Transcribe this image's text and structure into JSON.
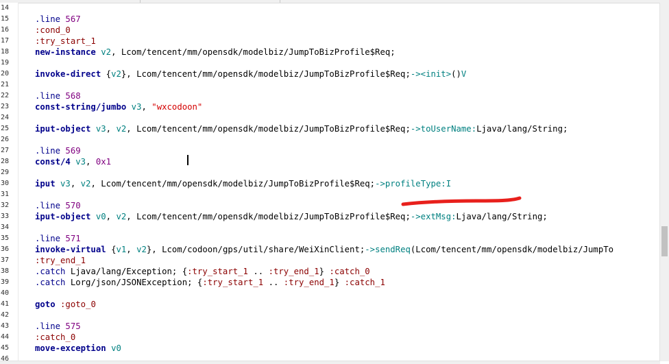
{
  "editor": {
    "lines": [
      {
        "n": "14",
        "segs": []
      },
      {
        "n": "15",
        "segs": [
          {
            "c": "dir",
            "t": ".line "
          },
          {
            "c": "num",
            "t": "567"
          }
        ]
      },
      {
        "n": "16",
        "segs": [
          {
            "c": "lbl",
            "t": ":cond_0"
          }
        ]
      },
      {
        "n": "17",
        "segs": [
          {
            "c": "lbl",
            "t": ":try_start_1"
          }
        ]
      },
      {
        "n": "18",
        "segs": [
          {
            "c": "kw",
            "t": "new-instance "
          },
          {
            "c": "reg",
            "t": "v2"
          },
          {
            "c": "punc",
            "t": ", Lcom/tencent/mm/opensdk/modelbiz/JumpToBizProfile$Req;"
          }
        ]
      },
      {
        "n": "19",
        "segs": []
      },
      {
        "n": "20",
        "segs": [
          {
            "c": "kw",
            "t": "invoke-direct "
          },
          {
            "c": "punc",
            "t": "{"
          },
          {
            "c": "reg",
            "t": "v2"
          },
          {
            "c": "punc",
            "t": "}, Lcom/tencent/mm/opensdk/modelbiz/JumpToBizProfile$Req;"
          },
          {
            "c": "mem",
            "t": "-><init>"
          },
          {
            "c": "punc",
            "t": "()"
          },
          {
            "c": "mem",
            "t": "V"
          }
        ]
      },
      {
        "n": "21",
        "segs": []
      },
      {
        "n": "22",
        "segs": [
          {
            "c": "dir",
            "t": ".line "
          },
          {
            "c": "num",
            "t": "568"
          }
        ]
      },
      {
        "n": "23",
        "segs": [
          {
            "c": "kw",
            "t": "const-string/jumbo "
          },
          {
            "c": "reg",
            "t": "v3"
          },
          {
            "c": "punc",
            "t": ", "
          },
          {
            "c": "str",
            "t": "\"wxcodoon\""
          }
        ]
      },
      {
        "n": "24",
        "segs": []
      },
      {
        "n": "25",
        "segs": [
          {
            "c": "kw",
            "t": "iput-object "
          },
          {
            "c": "reg",
            "t": "v3"
          },
          {
            "c": "punc",
            "t": ", "
          },
          {
            "c": "reg",
            "t": "v2"
          },
          {
            "c": "punc",
            "t": ", Lcom/tencent/mm/opensdk/modelbiz/JumpToBizProfile$Req;"
          },
          {
            "c": "mem",
            "t": "->toUserName:"
          },
          {
            "c": "punc",
            "t": "Ljava/lang/String;"
          }
        ]
      },
      {
        "n": "26",
        "segs": []
      },
      {
        "n": "27",
        "segs": [
          {
            "c": "dir",
            "t": ".line "
          },
          {
            "c": "num",
            "t": "569"
          }
        ]
      },
      {
        "n": "28",
        "segs": [
          {
            "c": "kw",
            "t": "const/4 "
          },
          {
            "c": "reg",
            "t": "v3"
          },
          {
            "c": "punc",
            "t": ", "
          },
          {
            "c": "num",
            "t": "0x1"
          }
        ]
      },
      {
        "n": "29",
        "segs": []
      },
      {
        "n": "30",
        "segs": [
          {
            "c": "kw",
            "t": "iput "
          },
          {
            "c": "reg",
            "t": "v3"
          },
          {
            "c": "punc",
            "t": ", "
          },
          {
            "c": "reg",
            "t": "v2"
          },
          {
            "c": "punc",
            "t": ", Lcom/tencent/mm/opensdk/modelbiz/JumpToBizProfile$Req;"
          },
          {
            "c": "mem",
            "t": "->profileType:I"
          }
        ]
      },
      {
        "n": "31",
        "segs": []
      },
      {
        "n": "32",
        "segs": [
          {
            "c": "dir",
            "t": ".line "
          },
          {
            "c": "num",
            "t": "570"
          }
        ]
      },
      {
        "n": "33",
        "segs": [
          {
            "c": "kw",
            "t": "iput-object "
          },
          {
            "c": "reg",
            "t": "v0"
          },
          {
            "c": "punc",
            "t": ", "
          },
          {
            "c": "reg",
            "t": "v2"
          },
          {
            "c": "punc",
            "t": ", Lcom/tencent/mm/opensdk/modelbiz/JumpToBizProfile$Req;"
          },
          {
            "c": "mem",
            "t": "->extMsg:"
          },
          {
            "c": "punc",
            "t": "Ljava/lang/String;"
          }
        ]
      },
      {
        "n": "34",
        "segs": []
      },
      {
        "n": "35",
        "segs": [
          {
            "c": "dir",
            "t": ".line "
          },
          {
            "c": "num",
            "t": "571"
          }
        ]
      },
      {
        "n": "36",
        "segs": [
          {
            "c": "kw",
            "t": "invoke-virtual "
          },
          {
            "c": "punc",
            "t": "{"
          },
          {
            "c": "reg",
            "t": "v1"
          },
          {
            "c": "punc",
            "t": ", "
          },
          {
            "c": "reg",
            "t": "v2"
          },
          {
            "c": "punc",
            "t": "}, Lcom/codoon/gps/util/share/WeiXinClient;"
          },
          {
            "c": "mem",
            "t": "->sendReq"
          },
          {
            "c": "punc",
            "t": "(Lcom/tencent/mm/opensdk/modelbiz/JumpTo"
          }
        ]
      },
      {
        "n": "37",
        "segs": [
          {
            "c": "lbl",
            "t": ":try_end_1"
          }
        ]
      },
      {
        "n": "38",
        "segs": [
          {
            "c": "dir",
            "t": ".catch "
          },
          {
            "c": "punc",
            "t": "Ljava/lang/Exception; {"
          },
          {
            "c": "lbl",
            "t": ":try_start_1"
          },
          {
            "c": "punc",
            "t": " .. "
          },
          {
            "c": "lbl",
            "t": ":try_end_1"
          },
          {
            "c": "punc",
            "t": "} "
          },
          {
            "c": "lbl",
            "t": ":catch_0"
          }
        ]
      },
      {
        "n": "39",
        "segs": [
          {
            "c": "dir",
            "t": ".catch "
          },
          {
            "c": "punc",
            "t": "Lorg/json/JSONException; {"
          },
          {
            "c": "lbl",
            "t": ":try_start_1"
          },
          {
            "c": "punc",
            "t": " .. "
          },
          {
            "c": "lbl",
            "t": ":try_end_1"
          },
          {
            "c": "punc",
            "t": "} "
          },
          {
            "c": "lbl",
            "t": ":catch_1"
          }
        ]
      },
      {
        "n": "40",
        "segs": []
      },
      {
        "n": "41",
        "segs": [
          {
            "c": "kw",
            "t": "goto "
          },
          {
            "c": "lbl",
            "t": ":goto_0"
          }
        ]
      },
      {
        "n": "42",
        "segs": []
      },
      {
        "n": "43",
        "segs": [
          {
            "c": "dir",
            "t": ".line "
          },
          {
            "c": "num",
            "t": "575"
          }
        ]
      },
      {
        "n": "44",
        "segs": [
          {
            "c": "lbl",
            "t": ":catch_0"
          }
        ]
      },
      {
        "n": "45",
        "segs": [
          {
            "c": "kw",
            "t": "move-exception "
          },
          {
            "c": "reg",
            "t": "v0"
          }
        ]
      },
      {
        "n": "46",
        "segs": []
      }
    ]
  },
  "colors": {
    "keyword": "#00008b",
    "label": "#8b0000",
    "number": "#800080",
    "register": "#008080",
    "string": "#d40000",
    "annotation": "#e8201c"
  }
}
